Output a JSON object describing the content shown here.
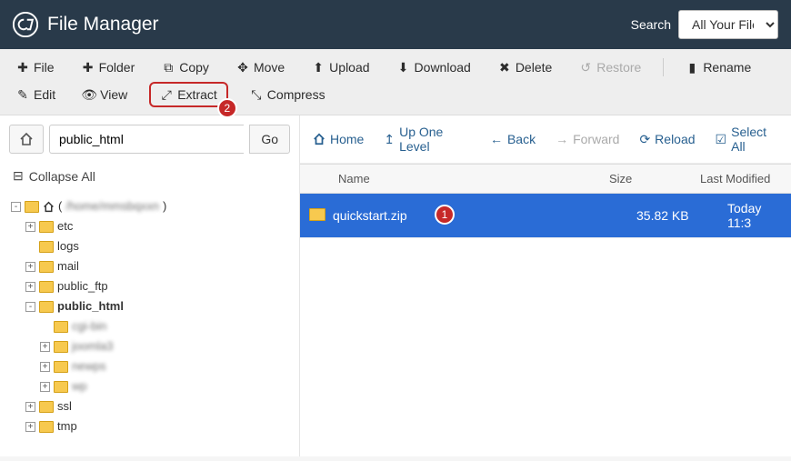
{
  "header": {
    "title": "File Manager",
    "search_label": "Search",
    "search_select": "All Your Files"
  },
  "toolbar": {
    "file": "File",
    "folder": "Folder",
    "copy": "Copy",
    "move": "Move",
    "upload": "Upload",
    "download": "Download",
    "delete": "Delete",
    "restore": "Restore",
    "rename": "Rename",
    "edit": "Edit",
    "view": "View",
    "extract": "Extract",
    "compress": "Compress"
  },
  "path": {
    "value": "public_html",
    "go": "Go"
  },
  "collapse_all": "Collapse All",
  "tree": {
    "root_label_prefix": "(",
    "root_label_blur": "/home/mmsbqxxn",
    "root_label_suffix": ")",
    "items": [
      {
        "label": "etc",
        "toggle": "+"
      },
      {
        "label": "logs",
        "toggle": ""
      },
      {
        "label": "mail",
        "toggle": "+"
      },
      {
        "label": "public_ftp",
        "toggle": "+"
      },
      {
        "label": "public_html",
        "toggle": "-",
        "bold": true,
        "children": [
          {
            "label": "cgi-bin",
            "blur": true,
            "toggle": ""
          },
          {
            "label": "joomla3",
            "blur": true,
            "toggle": "+"
          },
          {
            "label": "newps",
            "blur": true,
            "toggle": "+"
          },
          {
            "label": "wp",
            "blur": true,
            "toggle": "+"
          }
        ]
      },
      {
        "label": "ssl",
        "toggle": "+"
      },
      {
        "label": "tmp",
        "toggle": "+"
      }
    ]
  },
  "actionbar": {
    "home": "Home",
    "up": "Up One Level",
    "back": "Back",
    "forward": "Forward",
    "reload": "Reload",
    "select_all": "Select All"
  },
  "table": {
    "headers": {
      "name": "Name",
      "size": "Size",
      "modified": "Last Modified"
    },
    "rows": [
      {
        "name": "quickstart.zip",
        "size": "35.82 KB",
        "modified": "Today 11:3"
      }
    ]
  },
  "badges": {
    "file": "1",
    "extract": "2"
  }
}
